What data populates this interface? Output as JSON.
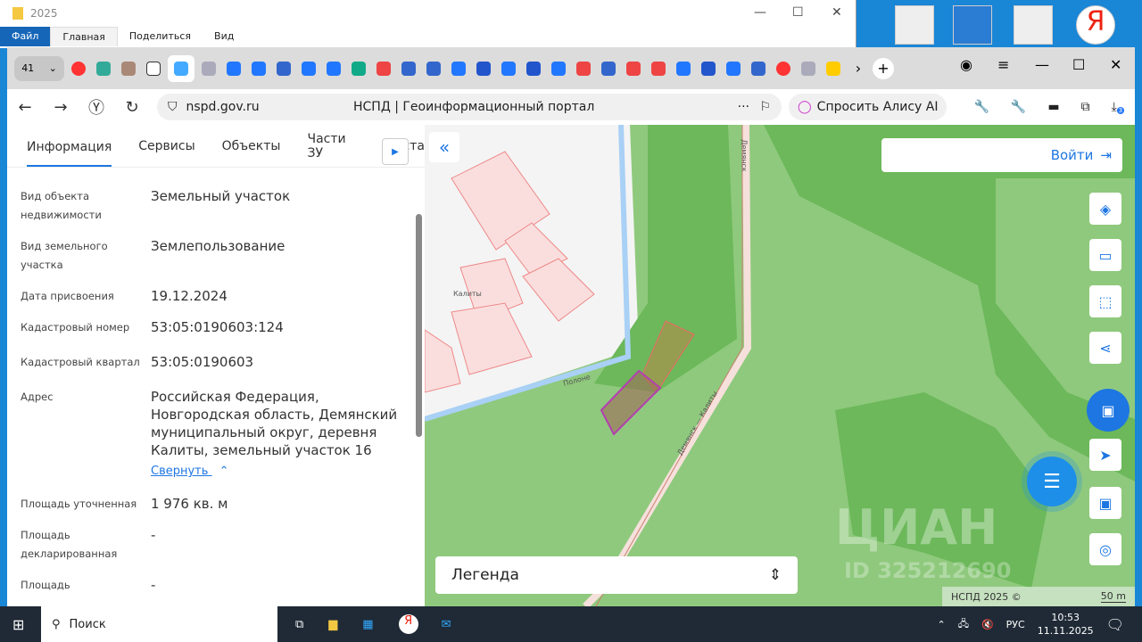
{
  "explorer": {
    "title": "2025",
    "ribbon": [
      "Файл",
      "Главная",
      "Поделиться",
      "Вид"
    ]
  },
  "browser": {
    "tab_count": "41",
    "url": "nspd.gov.ru",
    "page_title": "НСПД | Геоинформационный портал",
    "alice": "Спросить Алису AI",
    "downloads_badge": "3"
  },
  "panel": {
    "tabs": [
      "Информация",
      "Сервисы",
      "Объекты",
      "Части ЗУ",
      "Соста"
    ],
    "fields": [
      {
        "label": "Вид объекта недвижимости",
        "value": "Земельный участок"
      },
      {
        "label": "Вид земельного участка",
        "value": "Землепользование"
      },
      {
        "label": "Дата присвоения",
        "value": "19.12.2024"
      },
      {
        "label": "Кадастровый номер",
        "value": "53:05:0190603:124"
      },
      {
        "label": "Кадастровый квартал",
        "value": "53:05:0190603"
      },
      {
        "label": "Адрес",
        "value": "Российская Федерация, Новгородская область, Демянский муниципальный округ, деревня Калиты, земельный участок 16"
      },
      {
        "label": "Площадь уточненная",
        "value": "1 976 кв. м"
      },
      {
        "label": "Площадь декларированная",
        "value": "-"
      },
      {
        "label": "Площадь",
        "value": "-"
      }
    ],
    "collapse_link": "Свернуть"
  },
  "map": {
    "login": "Войти",
    "legend": "Легенда",
    "copyright": "НСПД 2025 ©",
    "scale": "50 m",
    "labels": {
      "village": "Калиты",
      "road1": "Демянск — Калиты",
      "road2": "Полоне",
      "road3": "Демянск"
    },
    "watermark": "ЦИАН",
    "watermark_id": "ID 325212690",
    "colors": {
      "forest": "#6cb85a",
      "field": "#8fc97d",
      "parcel": "#b33fb0",
      "accent": "#1d76e2"
    }
  },
  "taskbar": {
    "search": "Поиск",
    "lang": "РУС",
    "time": "10:53",
    "date": "11.11.2025"
  }
}
